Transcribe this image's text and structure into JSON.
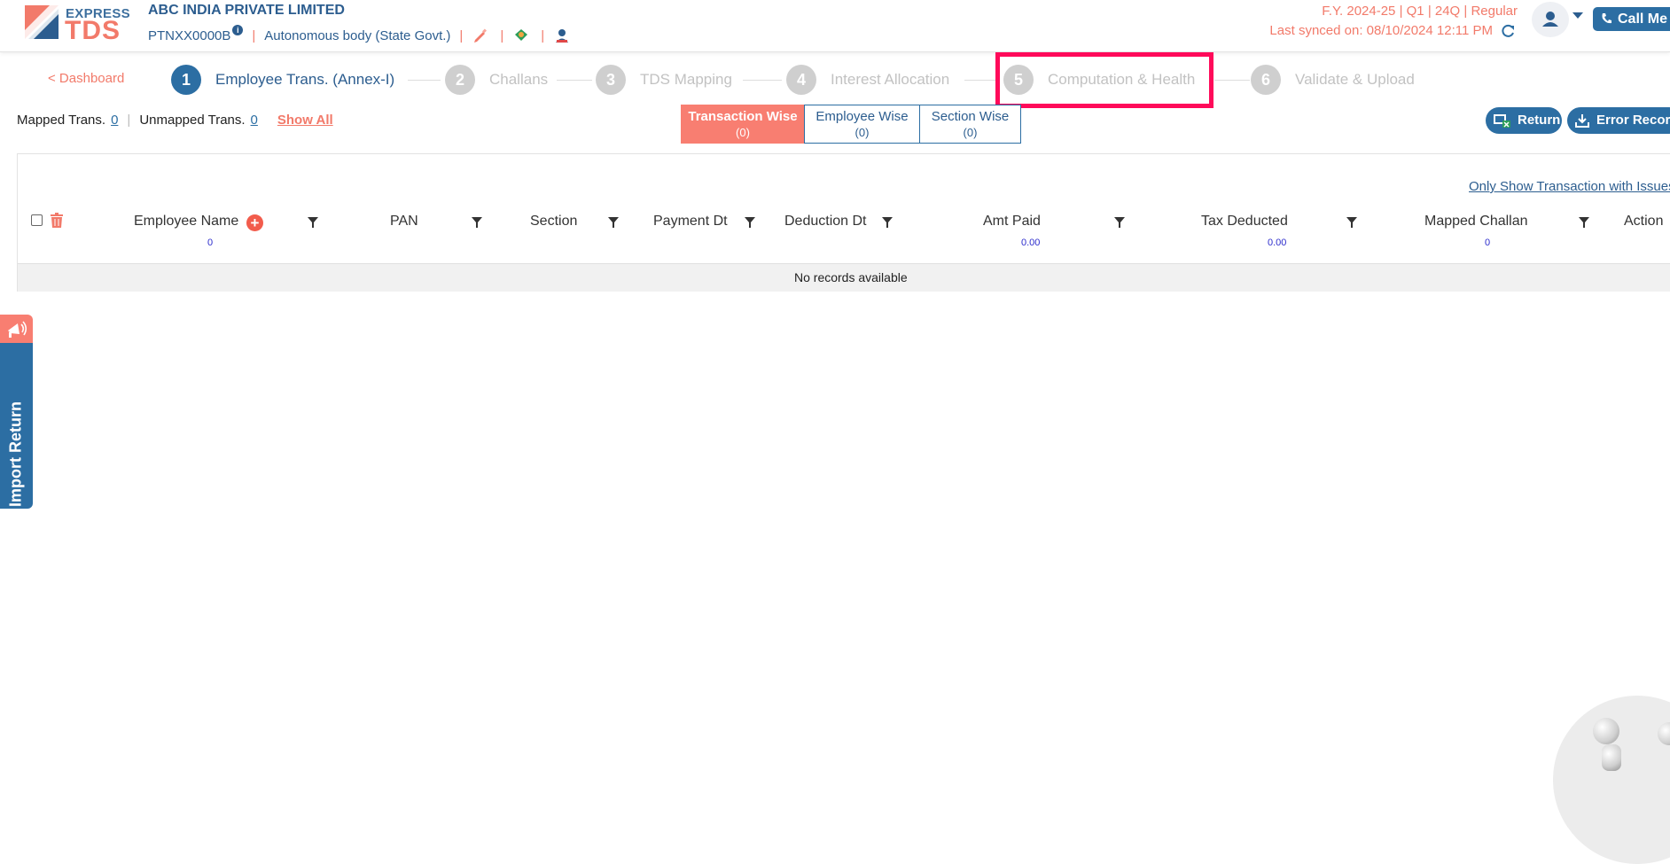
{
  "header": {
    "logo_express": "EXPRESS",
    "logo_tds": "TDS",
    "company_name": "ABC INDIA PRIVATE LIMITED",
    "pan": "PTNXX0000B",
    "info_badge": "i",
    "deductor_type": "Autonomous body (State Govt.)",
    "separator": "|",
    "fy_line": "F.Y. 2024-25  | Q1  | 24Q | Regular",
    "last_synced": "Last synced on: 08/10/2024 12:11 PM",
    "call_me_label": "Call Me"
  },
  "stepper": {
    "back_label": "< Dashboard",
    "steps": [
      {
        "num": "1",
        "label": "Employee Trans. (Annex-I)"
      },
      {
        "num": "2",
        "label": "Challans"
      },
      {
        "num": "3",
        "label": "TDS Mapping"
      },
      {
        "num": "4",
        "label": "Interest Allocation"
      },
      {
        "num": "5",
        "label": "Computation & Health"
      },
      {
        "num": "6",
        "label": "Validate & Upload"
      }
    ]
  },
  "toolbar": {
    "mapped_label": "Mapped Trans.",
    "mapped_count": "0",
    "unmapped_label": "Unmapped Trans.",
    "unmapped_count": "0",
    "show_all": "Show All",
    "views": [
      {
        "label": "Transaction Wise",
        "count": "(0)"
      },
      {
        "label": "Employee Wise",
        "count": "(0)"
      },
      {
        "label": "Section Wise",
        "count": "(0)"
      }
    ],
    "return_label": "Return",
    "error_records_label": "Error Records"
  },
  "grid": {
    "only_show_issues": "Only Show Transaction with Issues",
    "columns": {
      "employee_name": "Employee Name",
      "pan": "PAN",
      "section": "Section",
      "payment_dt": "Payment Dt",
      "deduction_dt": "Deduction Dt",
      "amt_paid": "Amt Paid",
      "tax_deducted": "Tax Deducted",
      "mapped_challan": "Mapped Challan",
      "action": "Action"
    },
    "totals": {
      "employee_count": "0",
      "amt_paid": "0.00",
      "tax_deducted": "0.00",
      "mapped_challan": "0"
    },
    "empty_message": "No records available"
  },
  "side_tab": {
    "label": "Import Return"
  },
  "colors": {
    "brand_blue": "#2c6ea3",
    "accent_coral": "#f87e71",
    "highlight": "#ff0a5a"
  }
}
